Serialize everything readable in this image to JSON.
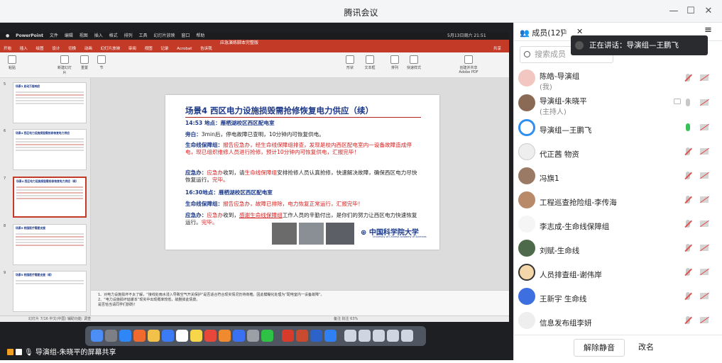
{
  "window": {
    "title": "腾讯会议"
  },
  "mac_menu": [
    "PowerPoint",
    "文件",
    "编辑",
    "视图",
    "插入",
    "格式",
    "排列",
    "工具",
    "幻灯片放映",
    "窗口",
    "帮助"
  ],
  "mac_status": "5月13日周六 21:51",
  "ppt": {
    "doc_title": "应急演练脚本完整版",
    "tabs": [
      "开始",
      "插入",
      "绘图",
      "设计",
      "切换",
      "动画",
      "幻灯片放映",
      "审阅",
      "视图",
      "记录",
      "Acrobat",
      "告诉我"
    ],
    "share_label": "共享",
    "ribbon": [
      "粘贴",
      "新建幻灯片",
      "重置",
      "节",
      "形状",
      "文本框",
      "排列",
      "快速样式",
      "创建并共享 Adobe PDF"
    ],
    "thumb_nums": [
      "5",
      "6",
      "7",
      "8",
      "9"
    ],
    "thumb_titles": [
      "场景3 启动万能响应",
      "场景4 西区电力设施损毁需抢修恢复电力供应",
      "场景4 西区电力设施损毁需抢修恢复电力供应（续）",
      "场景5 校园医疗需要支援",
      "场景5 校园医疗需要支援（续）"
    ],
    "slide": {
      "title": "场景4 西区电力设施损毁需抢修恢复电力供应（续）",
      "l1": "14:53 地点：雁栖湖校区西区配电室",
      "l2a": "旁白：",
      "l2b": "3min后，停电故障已查明，10分钟内可恢复供电。",
      "l3a": "生命线保障组：",
      "l3b": "报告应急办，经生命线保障组排查，发现是校内西区配电室内一设备故障造成停电，现已组织维修人员进行抢修，预计10分钟内可恢复供电，汇报完毕！",
      "l4a": "应急办：",
      "l4b": "应急办",
      "l4c": "收到，请",
      "l4d": "生命线保障组",
      "l4e": "安排抢修人员认真抢修，快速解决故障，确保西区电力尽快恢复运行。",
      "l4f": "完毕。",
      "l5": "16:30地点：雁栖湖校区西区配电室",
      "l6a": "生命线保障组：",
      "l6b": "报告应急办，故障已排除，电力恢复正常运行，汇报完毕！",
      "l7a": "应急办：",
      "l7b": "应急办",
      "l7c": "收到，",
      "l7d": "感谢生命线保障组",
      "l7e": "工作人员的辛勤付出，是你们的努力让西区电力快速恢复运行。",
      "l7f": "完毕。",
      "logo": "中国科学院大学",
      "logo_en": "University of Chinese Academy of Sciences"
    },
    "notes": [
      "1、对电力设施损坏不太了解，“接线处雨水浸入导致空气开关保护”是否适合符合现实情况仍待商榷。因此模糊化处理为“配电室内一设备故障”。",
      "2、“电力设施损坏延缓本”现实中出现概率较低，故删掉此情景。",
      "是否恰当请同学们斟酌！"
    ],
    "status_left": "幻灯片 7/16    中文(中国)    辅助功能: 调查",
    "status_right": "备注    批注                  63%"
  },
  "sharer": "导演组-朱晓平的屏幕共享",
  "panel": {
    "tab_members": "成员(12)",
    "search_placeholder": "搜索成员",
    "speaking": "正在讲话：导演组—王鹏飞",
    "members": [
      {
        "name": "陈皓-导演组",
        "sub": "(我)",
        "mic": "off"
      },
      {
        "name": "导演组-朱晓平",
        "sub": "(主持人)",
        "mic": "idle"
      },
      {
        "name": "导演组—王鹏飞",
        "sub": "",
        "mic": "on"
      },
      {
        "name": "代正茜 物资",
        "sub": "",
        "mic": "off"
      },
      {
        "name": "冯旗1",
        "sub": "",
        "mic": "off"
      },
      {
        "name": "工程巡查抢险组-李传海",
        "sub": "",
        "mic": "off"
      },
      {
        "name": "李志成-生命线保障组",
        "sub": "",
        "mic": "off"
      },
      {
        "name": "刘赋-生命线",
        "sub": "",
        "mic": "off"
      },
      {
        "name": "人员排查组-谢伟岸",
        "sub": "",
        "mic": "off"
      },
      {
        "name": "王新宇 生命线",
        "sub": "",
        "mic": "off"
      },
      {
        "name": "信息发布组李妍",
        "sub": "",
        "mic": "off"
      }
    ],
    "btn_unmute": "解除静音",
    "btn_rename": "改名"
  },
  "colors": {
    "accent": "#c33a27",
    "slide_title": "#1d3a8a",
    "highlight": "#d62020",
    "mic_on": "#3ac15a"
  }
}
